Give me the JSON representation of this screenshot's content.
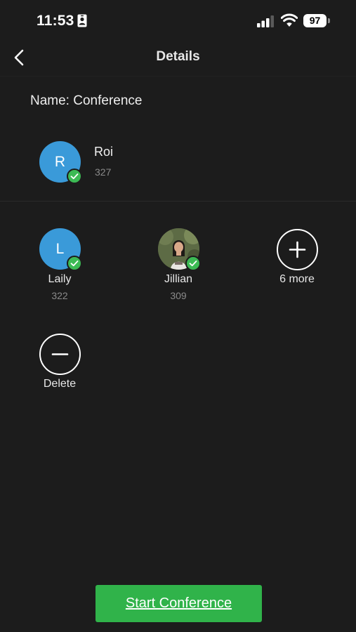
{
  "status_bar": {
    "time": "11:53",
    "battery": "97"
  },
  "nav": {
    "title": "Details",
    "back_icon": "chevron-left-icon"
  },
  "conference": {
    "name_text": "Name: Conference"
  },
  "host": {
    "initial": "R",
    "name": "Roi",
    "extension": "327"
  },
  "members": [
    {
      "initial": "L",
      "name": "Laily",
      "extension": "322"
    },
    {
      "initial": "",
      "name": "Jillian",
      "extension": "309"
    }
  ],
  "actions": {
    "more_label": "6 more",
    "delete_label": "Delete",
    "start_label": "Start Conference"
  },
  "colors": {
    "background": "#1c1c1c",
    "avatar_blue": "#3a9ad9",
    "check_green": "#3cba54",
    "button_green": "#30b34a"
  }
}
